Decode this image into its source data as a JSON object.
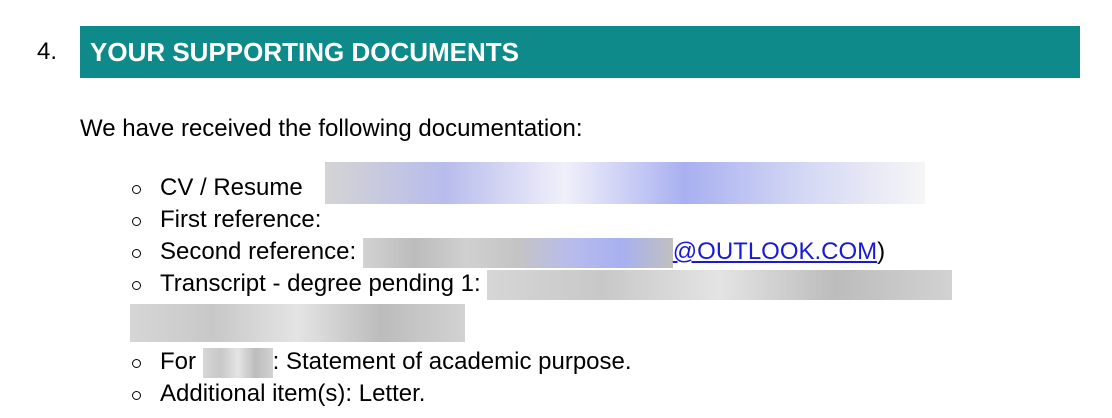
{
  "section": {
    "number": "4.",
    "title": "YOUR SUPPORTING DOCUMENTS"
  },
  "intro": "We have received the following documentation:",
  "items": [
    {
      "label": "CV / Resume"
    },
    {
      "label": "First reference:"
    },
    {
      "label": "Second reference:",
      "email_suffix": "@OUTLOOK.COM",
      "close": ")"
    },
    {
      "label": "Transcript - degree pending 1:"
    },
    {
      "prefix": "For",
      "label": ": Statement of academic purpose."
    },
    {
      "label": "Additional item(s): Letter."
    }
  ]
}
